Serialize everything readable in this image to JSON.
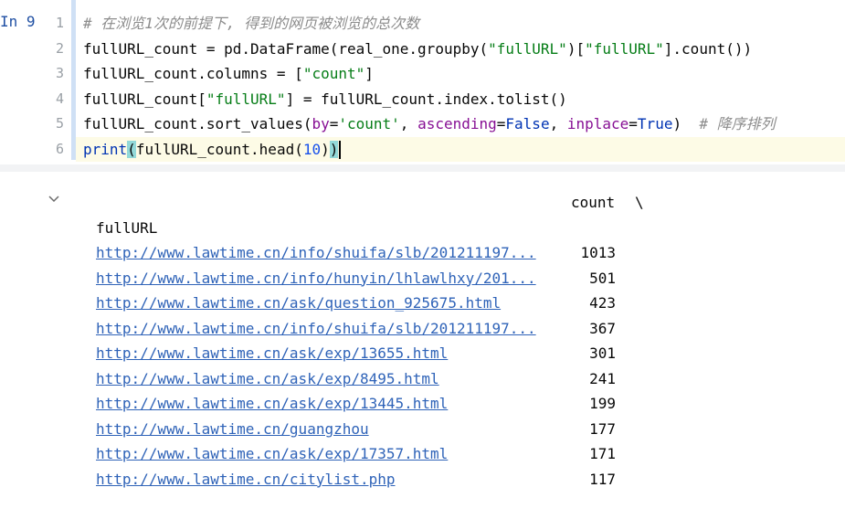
{
  "cell": {
    "prompt": "In 9",
    "line_numbers": [
      "1",
      "2",
      "3",
      "4",
      "5",
      "6"
    ],
    "lines": {
      "l1_comment": "# 在浏览1次的前提下, 得到的网页被浏览的总次数",
      "l2_a": "fullURL_count = pd.DataFrame(real_one.groupby(",
      "l2_s1": "\"fullURL\"",
      "l2_b": ")[",
      "l2_s2": "\"fullURL\"",
      "l2_c": "].count())",
      "l3_a": "fullURL_count.columns = [",
      "l3_s": "\"count\"",
      "l3_b": "]",
      "l4_a": "fullURL_count[",
      "l4_s": "\"fullURL\"",
      "l4_b": "] = fullURL_count.index.tolist()",
      "l5_a": "fullURL_count.sort_values(",
      "l5_kw1": "by",
      "l5_eq1": "=",
      "l5_s": "'count'",
      "l5_sep1": ", ",
      "l5_kw2": "ascending",
      "l5_eq2": "=",
      "l5_v2": "False",
      "l5_sep2": ", ",
      "l5_kw3": "inplace",
      "l5_eq3": "=",
      "l5_v3": "True",
      "l5_close": ")",
      "l5_comment": "  # 降序排列",
      "l6_print": "print",
      "l6_open": "(",
      "l6_mid": "fullURL_count.head(",
      "l6_num": "10",
      "l6_close1": ")",
      "l6_close2": ")"
    }
  },
  "output": {
    "column_header": "count",
    "continuation": "\\",
    "index_name": "fullURL",
    "rows": [
      {
        "url": "http://www.lawtime.cn/info/shuifa/slb/201211197...",
        "count": "1013"
      },
      {
        "url": "http://www.lawtime.cn/info/hunyin/lhlawlhxy/201...",
        "count": "501"
      },
      {
        "url": "http://www.lawtime.cn/ask/question_925675.html",
        "count": "423"
      },
      {
        "url": "http://www.lawtime.cn/info/shuifa/slb/201211197...",
        "count": "367"
      },
      {
        "url": "http://www.lawtime.cn/ask/exp/13655.html",
        "count": "301"
      },
      {
        "url": "http://www.lawtime.cn/ask/exp/8495.html",
        "count": "241"
      },
      {
        "url": "http://www.lawtime.cn/ask/exp/13445.html",
        "count": "199"
      },
      {
        "url": "http://www.lawtime.cn/guangzhou",
        "count": "177"
      },
      {
        "url": "http://www.lawtime.cn/ask/exp/17357.html",
        "count": "171"
      },
      {
        "url": "http://www.lawtime.cn/citylist.php",
        "count": "117"
      }
    ]
  },
  "icons": {
    "collapse": "chevron-down-icon"
  },
  "colors": {
    "comment": "#8c8c8c",
    "string": "#067d17",
    "keyword_arg": "#871094",
    "number": "#1750eb",
    "builtin": "#0033b3",
    "link": "#2f63b8",
    "active_line": "#fdfbe6",
    "cell_bar": "#cfe0f5"
  }
}
